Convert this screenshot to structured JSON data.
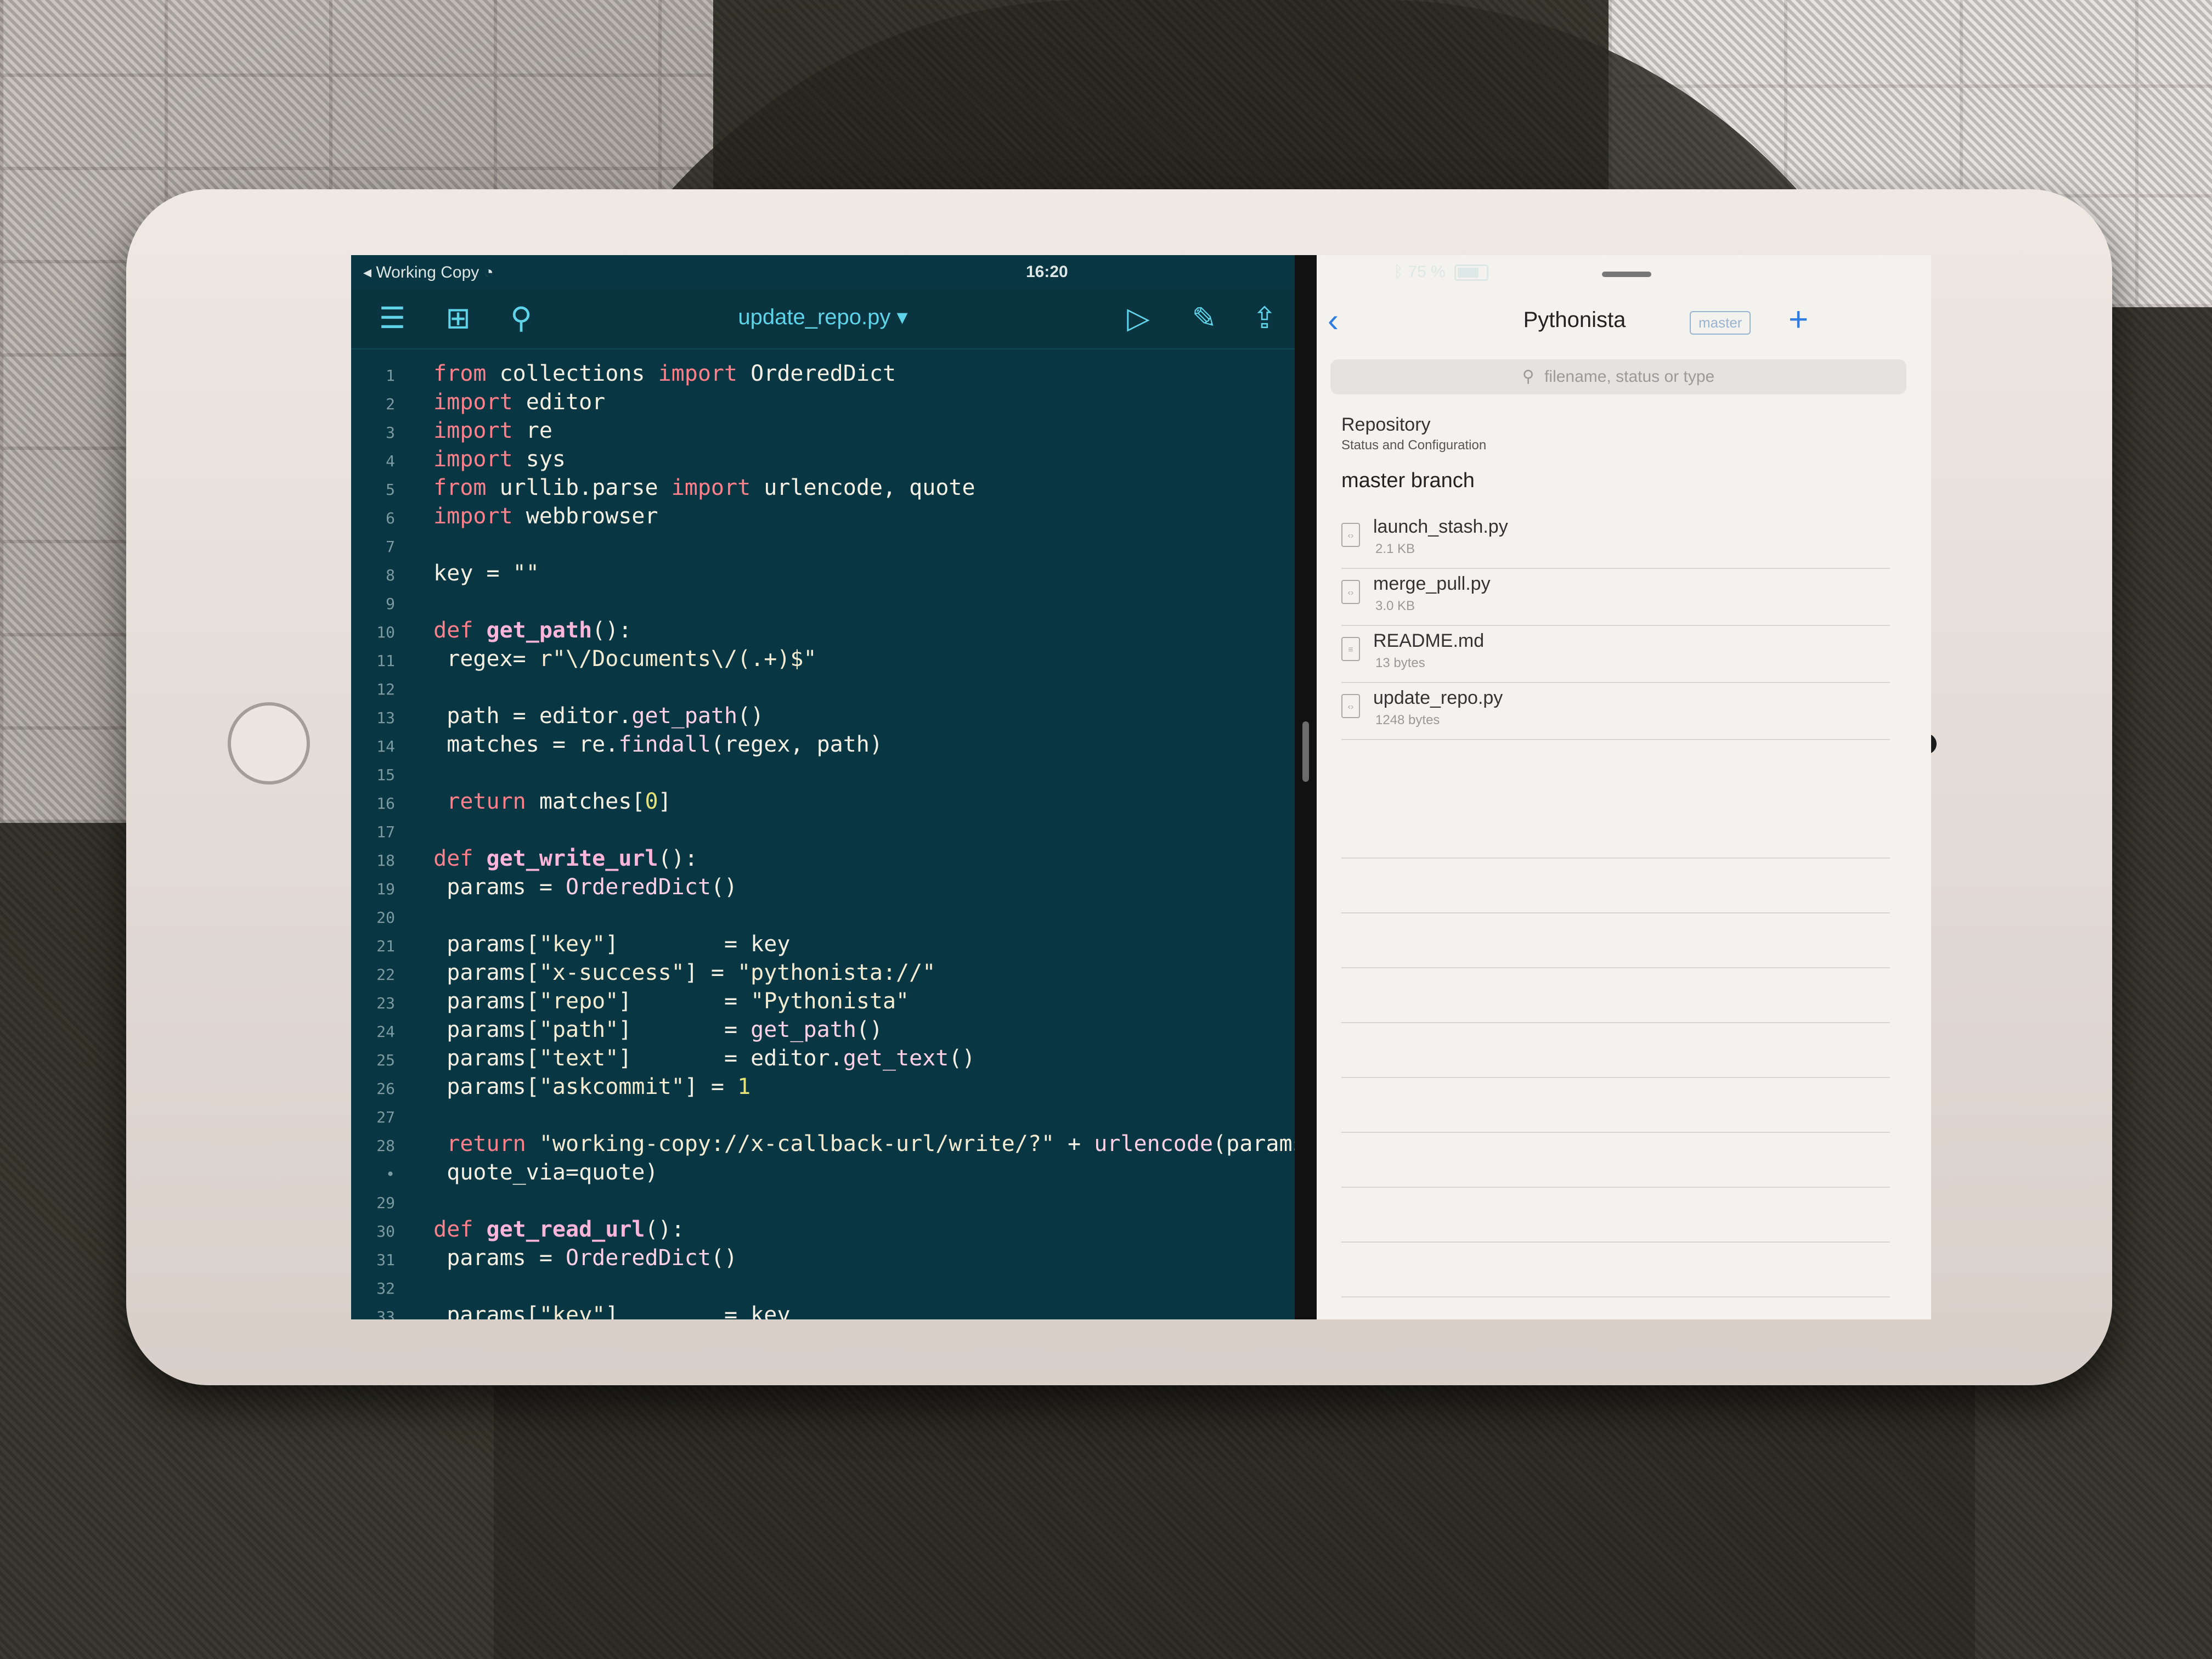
{
  "status_bar": {
    "app_back_label": "Working Copy",
    "time": "16:20",
    "battery_text": "75 %",
    "battery_level": 0.75
  },
  "editor": {
    "file_title": "update_repo.py ▾",
    "toolbar_icons": [
      "menu-icon",
      "new-file-icon",
      "search-icon",
      "play-icon",
      "wrench-icon",
      "share-icon"
    ],
    "lines": [
      {
        "n": "1",
        "indent": 2,
        "tokens": [
          [
            "kw",
            "from "
          ],
          [
            "plain",
            "collections "
          ],
          [
            "kw",
            "import "
          ],
          [
            "plain",
            "OrderedDict"
          ]
        ]
      },
      {
        "n": "2",
        "indent": 2,
        "tokens": [
          [
            "kw",
            "import "
          ],
          [
            "plain",
            "editor"
          ]
        ]
      },
      {
        "n": "3",
        "indent": 2,
        "tokens": [
          [
            "kw",
            "import "
          ],
          [
            "plain",
            "re"
          ]
        ]
      },
      {
        "n": "4",
        "indent": 2,
        "tokens": [
          [
            "kw",
            "import "
          ],
          [
            "plain",
            "sys"
          ]
        ]
      },
      {
        "n": "5",
        "indent": 2,
        "tokens": [
          [
            "kw",
            "from "
          ],
          [
            "plain",
            "urllib.parse "
          ],
          [
            "kw",
            "import "
          ],
          [
            "plain",
            "urlencode, quote"
          ]
        ]
      },
      {
        "n": "6",
        "indent": 2,
        "tokens": [
          [
            "kw",
            "import "
          ],
          [
            "plain",
            "webbrowser"
          ]
        ]
      },
      {
        "n": "7",
        "indent": 0,
        "tokens": []
      },
      {
        "n": "8",
        "indent": 2,
        "tokens": [
          [
            "plain",
            "key = "
          ],
          [
            "str",
            "\"\""
          ]
        ]
      },
      {
        "n": "9",
        "indent": 0,
        "tokens": []
      },
      {
        "n": "10",
        "indent": 2,
        "tokens": [
          [
            "kw",
            "def "
          ],
          [
            "fn",
            "get_path"
          ],
          [
            "plain",
            "():"
          ]
        ]
      },
      {
        "n": "11",
        "indent": 3,
        "tokens": [
          [
            "plain",
            "regex= "
          ],
          [
            "str",
            "r\"\\/Documents\\/(.+)$\""
          ]
        ]
      },
      {
        "n": "12",
        "indent": 0,
        "tokens": []
      },
      {
        "n": "13",
        "indent": 3,
        "tokens": [
          [
            "plain",
            "path = editor."
          ],
          [
            "call",
            "get_path"
          ],
          [
            "plain",
            "()"
          ]
        ]
      },
      {
        "n": "14",
        "indent": 3,
        "tokens": [
          [
            "plain",
            "matches = re."
          ],
          [
            "call",
            "findall"
          ],
          [
            "plain",
            "(regex, path)"
          ]
        ]
      },
      {
        "n": "15",
        "indent": 0,
        "tokens": []
      },
      {
        "n": "16",
        "indent": 3,
        "tokens": [
          [
            "kw",
            "return "
          ],
          [
            "plain",
            "matches["
          ],
          [
            "num",
            "0"
          ],
          [
            "plain",
            "]"
          ]
        ]
      },
      {
        "n": "17",
        "indent": 0,
        "tokens": []
      },
      {
        "n": "18",
        "indent": 2,
        "tokens": [
          [
            "kw",
            "def "
          ],
          [
            "fn",
            "get_write_url"
          ],
          [
            "plain",
            "():"
          ]
        ]
      },
      {
        "n": "19",
        "indent": 3,
        "tokens": [
          [
            "plain",
            "params = "
          ],
          [
            "call",
            "OrderedDict"
          ],
          [
            "plain",
            "()"
          ]
        ]
      },
      {
        "n": "20",
        "indent": 0,
        "tokens": []
      },
      {
        "n": "21",
        "indent": 3,
        "tokens": [
          [
            "plain",
            "params["
          ],
          [
            "str",
            "\"key\""
          ],
          [
            "plain",
            "]        = key"
          ]
        ]
      },
      {
        "n": "22",
        "indent": 3,
        "tokens": [
          [
            "plain",
            "params["
          ],
          [
            "str",
            "\"x-success\""
          ],
          [
            "plain",
            "] = "
          ],
          [
            "str",
            "\"pythonista://\""
          ]
        ]
      },
      {
        "n": "23",
        "indent": 3,
        "tokens": [
          [
            "plain",
            "params["
          ],
          [
            "str",
            "\"repo\""
          ],
          [
            "plain",
            "]       = "
          ],
          [
            "str",
            "\"Pythonista\""
          ]
        ]
      },
      {
        "n": "24",
        "indent": 3,
        "tokens": [
          [
            "plain",
            "params["
          ],
          [
            "str",
            "\"path\""
          ],
          [
            "plain",
            "]       = "
          ],
          [
            "call",
            "get_path"
          ],
          [
            "plain",
            "()"
          ]
        ]
      },
      {
        "n": "25",
        "indent": 3,
        "tokens": [
          [
            "plain",
            "params["
          ],
          [
            "str",
            "\"text\""
          ],
          [
            "plain",
            "]       = editor."
          ],
          [
            "call",
            "get_text"
          ],
          [
            "plain",
            "()"
          ]
        ]
      },
      {
        "n": "26",
        "indent": 3,
        "tokens": [
          [
            "plain",
            "params["
          ],
          [
            "str",
            "\"askcommit\""
          ],
          [
            "plain",
            "] = "
          ],
          [
            "num",
            "1"
          ]
        ]
      },
      {
        "n": "27",
        "indent": 0,
        "tokens": []
      },
      {
        "n": "28",
        "indent": 3,
        "tokens": [
          [
            "kw",
            "return "
          ],
          [
            "str",
            "\"working-copy://x-callback-url/write/?\""
          ],
          [
            "plain",
            " + "
          ],
          [
            "call",
            "urlencode"
          ],
          [
            "plain",
            "(params,"
          ]
        ]
      },
      {
        "n": "•",
        "indent": 3,
        "tokens": [
          [
            "plain",
            "quote_via=quote)"
          ]
        ]
      },
      {
        "n": "29",
        "indent": 0,
        "tokens": []
      },
      {
        "n": "30",
        "indent": 2,
        "tokens": [
          [
            "kw",
            "def "
          ],
          [
            "fn",
            "get_read_url"
          ],
          [
            "plain",
            "():"
          ]
        ]
      },
      {
        "n": "31",
        "indent": 3,
        "tokens": [
          [
            "plain",
            "params = "
          ],
          [
            "call",
            "OrderedDict"
          ],
          [
            "plain",
            "()"
          ]
        ]
      },
      {
        "n": "32",
        "indent": 0,
        "tokens": []
      },
      {
        "n": "33",
        "indent": 3,
        "tokens": [
          [
            "plain",
            "params["
          ],
          [
            "str",
            "\"key\""
          ],
          [
            "plain",
            "]        = key"
          ]
        ]
      }
    ]
  },
  "repo_pane": {
    "title": "Pythonista",
    "branch_badge": "master",
    "search_placeholder": "filename, status or type",
    "repository_title": "Repository",
    "repository_subtitle": "Status and Configuration",
    "branch_header": "master branch",
    "files": [
      {
        "name": "launch_stash.py",
        "size": "2.1 KB",
        "icon": "python-file-icon"
      },
      {
        "name": "merge_pull.py",
        "size": "3.0 KB",
        "icon": "python-file-icon"
      },
      {
        "name": "README.md",
        "size": "13 bytes",
        "icon": "text-file-icon"
      },
      {
        "name": "update_repo.py",
        "size": "1248 bytes",
        "icon": "python-file-icon"
      }
    ]
  },
  "colors": {
    "editor_bg": "#083642",
    "accent": "#5fd3e8",
    "keyword": "#ff7f8b",
    "function": "#ffb4d9",
    "link_blue": "#2f7de0"
  }
}
